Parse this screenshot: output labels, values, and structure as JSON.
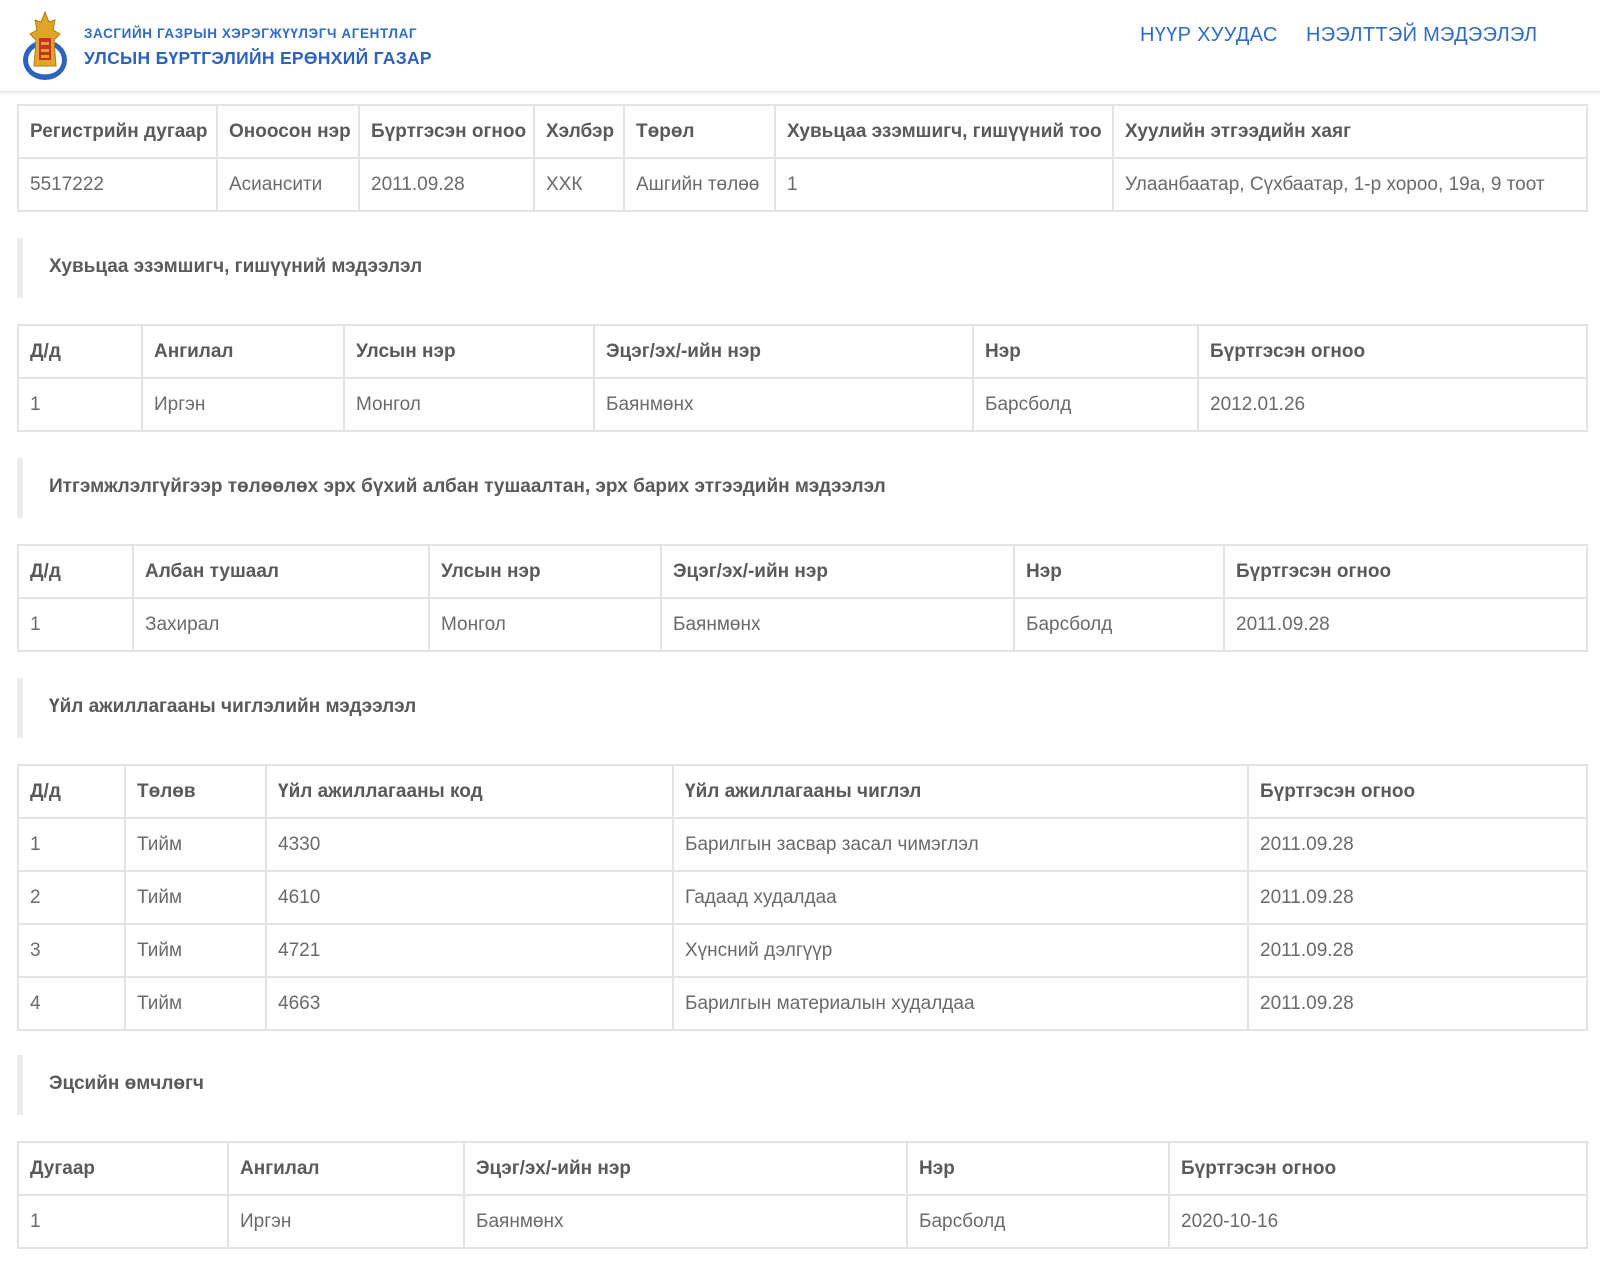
{
  "header": {
    "agency_line1": "ЗАСГИЙН ГАЗРЫН ХЭРЭГЖҮҮЛЭГЧ АГЕНТЛАГ",
    "agency_line2": "УЛСЫН БҮРТГЭЛИЙН ЕРӨНХИЙ ГАЗАР",
    "nav_home": "НҮҮР ХУУДАС",
    "nav_open_info": "НЭЭЛТТЭЙ МЭДЭЭЛЭЛ",
    "logo_icon": "soyombo-emblem-icon"
  },
  "colors": {
    "brand_blue": "#2f6cc6",
    "border": "#e3e3e3",
    "text": "#5a5a5a"
  },
  "company": {
    "headers": [
      "Регистрийн дугаар",
      "Оноосон нэр",
      "Бүртгэсэн огноо",
      "Хэлбэр",
      "Төрөл",
      "Хувьцаа эзэмшигч, гишүүний тоо",
      "Хуулийн этгээдийн хаяг"
    ],
    "row": [
      "5517222",
      "Асиансити",
      "2011.09.28",
      "ХХК",
      "Ашгийн төлөө",
      "1",
      "Улаанбаатар, Сүхбаатар, 1-р хороо, 19а, 9 тоот"
    ]
  },
  "shareholders": {
    "title": "Хувьцаа эзэмшигч, гишүүний мэдээлэл",
    "headers": [
      "Д/д",
      "Ангилал",
      "Улсын нэр",
      "Эцэг/эх/-ийн нэр",
      "Нэр",
      "Бүртгэсэн огноо"
    ],
    "rows": [
      [
        "1",
        "Иргэн",
        "Монгол",
        "Баянмөнх",
        "Барсболд",
        "2012.01.26"
      ]
    ]
  },
  "officials": {
    "title": "Итгэмжлэлгүйгээр төлөөлөх эрх бүхий албан тушаалтан, эрх барих этгээдийн мэдээлэл",
    "headers": [
      "Д/д",
      "Албан тушаал",
      "Улсын нэр",
      "Эцэг/эх/-ийн нэр",
      "Нэр",
      "Бүртгэсэн огноо"
    ],
    "rows": [
      [
        "1",
        "Захирал",
        "Монгол",
        "Баянмөнх",
        "Барсболд",
        "2011.09.28"
      ]
    ]
  },
  "activities": {
    "title": "Үйл ажиллагааны чиглэлийн мэдээлэл",
    "headers": [
      "Д/д",
      "Төлөв",
      "Үйл ажиллагааны код",
      "Үйл ажиллагааны чиглэл",
      "Бүртгэсэн огноо"
    ],
    "rows": [
      [
        "1",
        "Тийм",
        "4330",
        "Барилгын засвар засал чимэглэл",
        "2011.09.28"
      ],
      [
        "2",
        "Тийм",
        "4610",
        "Гадаад худалдаа",
        "2011.09.28"
      ],
      [
        "3",
        "Тийм",
        "4721",
        "Хүнсний дэлгүүр",
        "2011.09.28"
      ],
      [
        "4",
        "Тийм",
        "4663",
        "Барилгын материалын худалдаа",
        "2011.09.28"
      ]
    ]
  },
  "beneficial_owners": {
    "title": "Эцсийн өмчлөгч",
    "headers": [
      "Дугаар",
      "Ангилал",
      "Эцэг/эх/-ийн нэр",
      "Нэр",
      "Бүртгэсэн огноо"
    ],
    "rows": [
      [
        "1",
        "Иргэн",
        "Баянмөнх",
        "Барсболд",
        "2020-10-16"
      ]
    ]
  }
}
